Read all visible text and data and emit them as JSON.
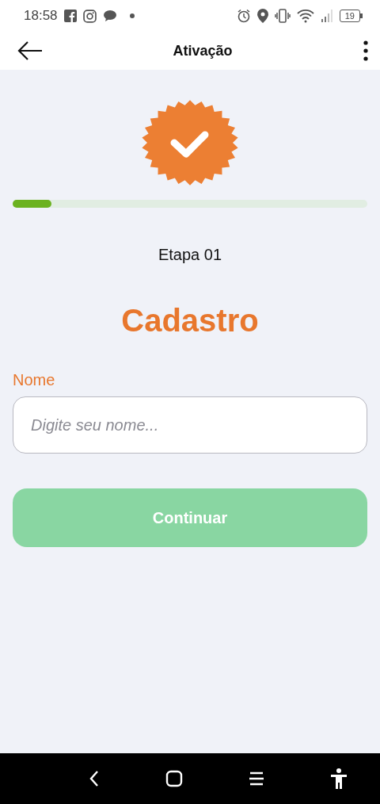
{
  "status_bar": {
    "time": "18:58",
    "battery": "19"
  },
  "app_bar": {
    "title": "Ativação"
  },
  "progress": {
    "level": 0.11
  },
  "step": "Etapa 01",
  "heading": "Cadastro",
  "field": {
    "label": "Nome",
    "placeholder": "Digite seu nome..."
  },
  "button": {
    "label": "Continuar",
    "disabled": true
  }
}
